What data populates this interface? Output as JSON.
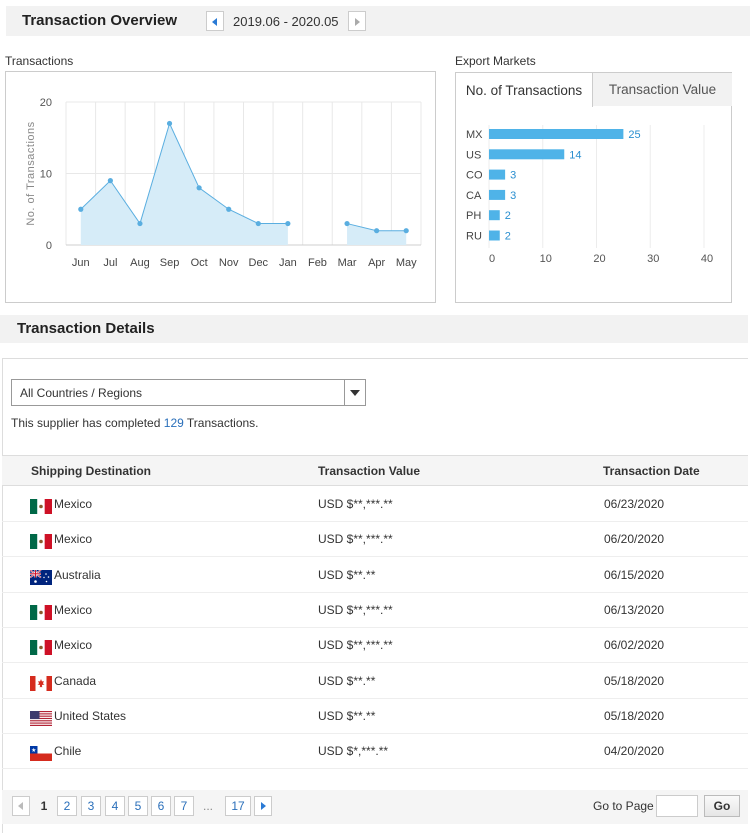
{
  "overview": {
    "title": "Transaction Overview",
    "date_range": "2019.06 - 2020.05"
  },
  "transactions_chart": {
    "section_label": "Transactions"
  },
  "export_markets": {
    "section_label": "Export Markets",
    "tabs": [
      {
        "label": "No. of Transactions",
        "active": true
      },
      {
        "label": "Transaction Value",
        "active": false
      }
    ]
  },
  "chart_data": [
    {
      "type": "area",
      "title": "Transactions",
      "xlabel": "",
      "ylabel": "No. of Transactions",
      "categories": [
        "Jun",
        "Jul",
        "Aug",
        "Sep",
        "Oct",
        "Nov",
        "Dec",
        "Jan",
        "Feb",
        "Mar",
        "Apr",
        "May"
      ],
      "values": [
        5,
        9,
        3,
        17,
        8,
        5,
        3,
        3,
        null,
        3,
        2,
        2
      ],
      "ylim": [
        0,
        20
      ],
      "yticks": [
        0,
        10,
        20
      ],
      "grid": true,
      "color": "#5aaee0",
      "fill": "#d6ecf8"
    },
    {
      "type": "bar",
      "orientation": "horizontal",
      "title": "Export Markets",
      "categories": [
        "MX",
        "US",
        "CO",
        "CA",
        "PH",
        "RU"
      ],
      "values": [
        25,
        14,
        3,
        3,
        2,
        2
      ],
      "xlim": [
        0,
        40
      ],
      "xticks": [
        0,
        10,
        20,
        30,
        40
      ],
      "grid": true,
      "color": "#4fb3e8"
    }
  ],
  "details": {
    "title": "Transaction Details",
    "select_value": "All Countries / Regions",
    "completed_prefix": "This supplier has completed",
    "completed_count": "129",
    "completed_suffix": "Transactions.",
    "columns": [
      "Shipping Destination",
      "Transaction Value",
      "Transaction Date"
    ],
    "rows": [
      {
        "country": "Mexico",
        "flag": "mexico",
        "value": "USD $**,***.**",
        "date": "06/23/2020"
      },
      {
        "country": "Mexico",
        "flag": "mexico",
        "value": "USD $**,***.**",
        "date": "06/20/2020"
      },
      {
        "country": "Australia",
        "flag": "australia",
        "value": "USD $**.**",
        "date": "06/15/2020"
      },
      {
        "country": "Mexico",
        "flag": "mexico",
        "value": "USD $**,***.**",
        "date": "06/13/2020"
      },
      {
        "country": "Mexico",
        "flag": "mexico",
        "value": "USD $**,***.**",
        "date": "06/02/2020"
      },
      {
        "country": "Canada",
        "flag": "canada",
        "value": "USD $**.**",
        "date": "05/18/2020"
      },
      {
        "country": "United States",
        "flag": "united-states",
        "value": "USD $**.**",
        "date": "05/18/2020"
      },
      {
        "country": "Chile",
        "flag": "chile",
        "value": "USD $*,***.**",
        "date": "04/20/2020"
      }
    ]
  },
  "pagination": {
    "current": "1",
    "pages": [
      "2",
      "3",
      "4",
      "5",
      "6",
      "7"
    ],
    "ellipsis": "...",
    "last": "17",
    "goto_label": "Go to Page",
    "go_label": "Go"
  },
  "colors": {
    "accent_blue": "#2a6fba",
    "chart_line": "#5aaee0",
    "bar": "#4fb3e8",
    "header_bg": "#f2f2f2"
  }
}
